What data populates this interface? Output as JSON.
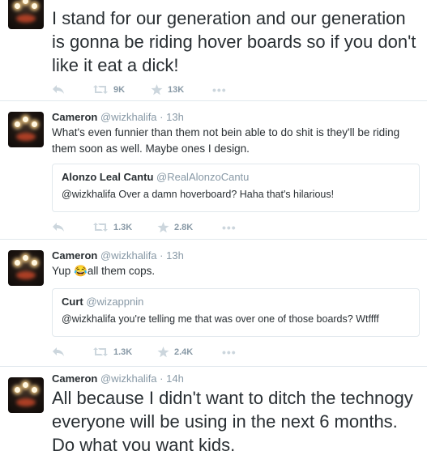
{
  "tweets": [
    {
      "text": "I stand for our generation and our generation is gonna be riding hover boards so if you don't like it eat a dick!",
      "retweets": "9K",
      "likes": "13K",
      "more": "•••"
    },
    {
      "name": "Cameron",
      "handle": "@wizkhalifa",
      "time": "· 13h",
      "text": "What's even funnier than them not bein able to do shit is they'll be riding them soon as well. Maybe ones I design.",
      "quote": {
        "name": "Alonzo Leal Cantu",
        "handle": "@RealAlonzoCantu",
        "text": "@wizkhalifa Over a damn hoverboard? Haha that's hilarious!"
      },
      "retweets": "1.3K",
      "likes": "2.8K",
      "more": "•••"
    },
    {
      "name": "Cameron",
      "handle": "@wizkhalifa",
      "time": "· 13h",
      "text_before": "Yup ",
      "emoji": "😂",
      "text_after": "all them cops.",
      "quote": {
        "name": "Curt",
        "handle": "@wizappnin",
        "text": "@wizkhalifa you're telling me that was over one of those boards? Wtffff"
      },
      "retweets": "1.3K",
      "likes": "2.4K",
      "more": "•••"
    },
    {
      "name": "Cameron",
      "handle": "@wizkhalifa",
      "time": "· 14h",
      "text": "All because I didn't want to ditch the technogy everyone will be using in the next 6 months. Do what you want kids."
    }
  ],
  "icons": {
    "reply": "reply-icon",
    "retweet": "retweet-icon",
    "like": "star-icon",
    "more": "more-icon"
  },
  "colors": {
    "text": "#292f33",
    "muted": "#8899a6",
    "icon": "#aab8c2",
    "border": "#e1e8ed"
  }
}
